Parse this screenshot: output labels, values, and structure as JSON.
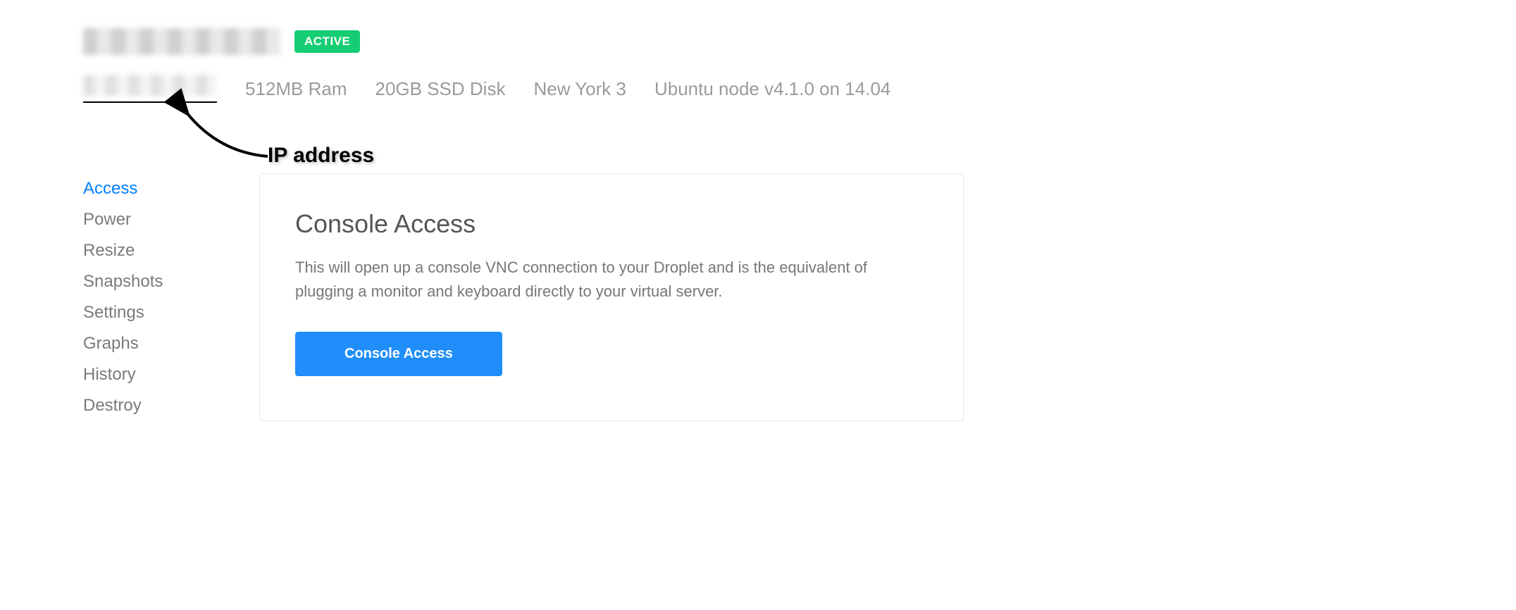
{
  "header": {
    "status_label": "ACTIVE"
  },
  "stats": {
    "ram": "512MB Ram",
    "disk": "20GB SSD Disk",
    "region": "New York 3",
    "image": "Ubuntu node v4.1.0 on 14.04"
  },
  "annotation": {
    "label": "IP address"
  },
  "sidebar": {
    "items": [
      {
        "label": "Access",
        "active": true
      },
      {
        "label": "Power",
        "active": false
      },
      {
        "label": "Resize",
        "active": false
      },
      {
        "label": "Snapshots",
        "active": false
      },
      {
        "label": "Settings",
        "active": false
      },
      {
        "label": "Graphs",
        "active": false
      },
      {
        "label": "History",
        "active": false
      },
      {
        "label": "Destroy",
        "active": false
      }
    ]
  },
  "panel": {
    "title": "Console Access",
    "description": "This will open up a console VNC connection to your Droplet and is the equivalent of plugging a monitor and keyboard directly to your virtual server.",
    "button_label": "Console Access"
  }
}
